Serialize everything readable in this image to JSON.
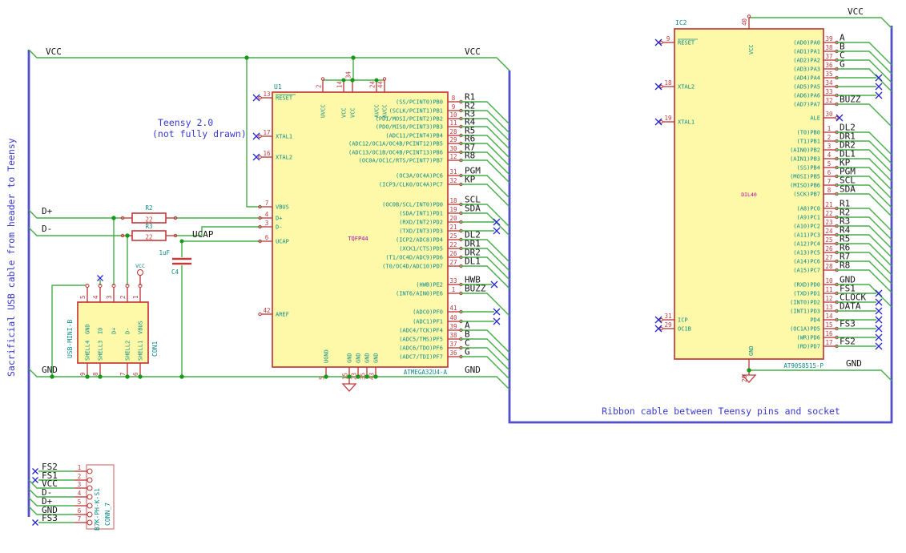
{
  "notes": {
    "left_cable": "Sacrificial USB cable from header to Teensy",
    "teensy_1": "Teensy 2.0",
    "teensy_2": "(not fully drawn)",
    "ribbon": "Ribbon cable between Teensy pins and socket"
  },
  "power": {
    "vcc": "VCC",
    "gnd": "GND"
  },
  "nets": {
    "dplus": "D+",
    "dminus": "D-",
    "ucap": "UCAP"
  },
  "u1": {
    "ref": "U1",
    "value": "ATMEGA32U4-A",
    "footprint": "TQFP44",
    "top_pins": [
      {
        "num": "2",
        "name": "UVCC"
      },
      {
        "num": "14",
        "name": "VCC"
      },
      {
        "num": "34",
        "name": "VCC"
      },
      {
        "num": "24",
        "name": "AVCC"
      },
      {
        "num": "44",
        "name": "AVCC"
      }
    ],
    "bottom_pins": [
      {
        "num": "5",
        "name": "UGND"
      },
      {
        "num": "15",
        "name": "GND"
      },
      {
        "num": "23",
        "name": "GND"
      },
      {
        "num": "35",
        "name": "GND"
      },
      {
        "num": "43",
        "name": "GND"
      }
    ],
    "left_pins": [
      {
        "num": "13",
        "name": "RESET"
      },
      {
        "num": "17",
        "name": "XTAL1"
      },
      {
        "num": "16",
        "name": "XTAL2"
      },
      {
        "num": "7",
        "name": "VBUS"
      },
      {
        "num": "4",
        "name": "D+"
      },
      {
        "num": "3",
        "name": "D-"
      },
      {
        "num": "6",
        "name": "UCAP"
      },
      {
        "num": "42",
        "name": "AREF"
      }
    ],
    "right_pins": [
      {
        "num": "8",
        "name": "(SS/PCINT0)PB0",
        "net": "R1"
      },
      {
        "num": "9",
        "name": "(SCLK/PCINT1)PB1",
        "net": "R2"
      },
      {
        "num": "10",
        "name": "(PDI/MOSI/PCINT2)PB2",
        "net": "R3"
      },
      {
        "num": "11",
        "name": "(PDO/MISO/PCINT3)PB3",
        "net": "R4"
      },
      {
        "num": "28",
        "name": "(ADC11/PCINT4)PB4",
        "net": "R5"
      },
      {
        "num": "29",
        "name": "(ADC12/OC1A/OC4B/PCINT12)PB5",
        "net": "R6"
      },
      {
        "num": "30",
        "name": "(ADC13/OC1B/OC4B/PCINT13)PB6",
        "net": "R7"
      },
      {
        "num": "12",
        "name": "(OC0A/OC1C/RTS/PCINT7)PB7",
        "net": "R8"
      },
      {
        "num": "31",
        "name": "(OC3A/OC4A)PC6",
        "net": "PGM"
      },
      {
        "num": "32",
        "name": "(ICP3/CLK0/OC4A)PC7",
        "net": "KP"
      },
      {
        "num": "18",
        "name": "(OC0B/SCL/INT0)PD0",
        "net": "SCL"
      },
      {
        "num": "19",
        "name": "(SDA/INT1)PD1",
        "net": "SDA"
      },
      {
        "num": "20",
        "name": "(RXD/INT2)PD2",
        "net": ""
      },
      {
        "num": "21",
        "name": "(TXD/INT3)PD3",
        "net": ""
      },
      {
        "num": "25",
        "name": "(ICP2/ADC8)PD4",
        "net": "DL2"
      },
      {
        "num": "22",
        "name": "(XCK1/CTS)PD5",
        "net": "DR1"
      },
      {
        "num": "26",
        "name": "(T1/OC4D/ADC9)PD6",
        "net": "DR2"
      },
      {
        "num": "27",
        "name": "(T0/OC4D/ADC10)PD7",
        "net": "DL1"
      },
      {
        "num": "33",
        "name": "(HWB)PE2",
        "net": "HWB"
      },
      {
        "num": "1",
        "name": "(INT6/AIN0)PE6",
        "net": "BUZZ"
      },
      {
        "num": "41",
        "name": "(ADC0)PF0",
        "net": ""
      },
      {
        "num": "40",
        "name": "(ADC1)PF1",
        "net": ""
      },
      {
        "num": "39",
        "name": "(ADC4/TCK)PF4",
        "net": "A"
      },
      {
        "num": "38",
        "name": "(ADC5/TMS)PF5",
        "net": "B"
      },
      {
        "num": "37",
        "name": "(ADC6/TDO)PF6",
        "net": "C"
      },
      {
        "num": "36",
        "name": "(ADC7/TDI)PF7",
        "net": "G"
      }
    ]
  },
  "r2c": {
    "ref": "R2",
    "value": "22"
  },
  "r3c": {
    "ref": "R3",
    "value": "22"
  },
  "c4": {
    "ref": "C4",
    "value": "1uF"
  },
  "con1": {
    "ref": "CON1",
    "value": "USB-MINI-B",
    "top_pins": [
      {
        "num": "5",
        "name": "GND"
      },
      {
        "num": "4",
        "name": "ID"
      },
      {
        "num": "3",
        "name": "D+"
      },
      {
        "num": "2",
        "name": "D-"
      },
      {
        "num": "1",
        "name": "VBUS"
      }
    ],
    "bottom_pins": [
      {
        "num": "9",
        "name": "SHELL4"
      },
      {
        "num": "8",
        "name": "SHELL3"
      },
      {
        "num": "7",
        "name": "SHELL2"
      },
      {
        "num": "6",
        "name": "SHELL1"
      }
    ]
  },
  "conn7": {
    "ref": "CONN_7",
    "value": "B7K-PH-K-S1",
    "pins": [
      {
        "num": "1",
        "net": "FS2"
      },
      {
        "num": "2",
        "net": "FS1"
      },
      {
        "num": "3",
        "net": "VCC"
      },
      {
        "num": "4",
        "net": "D-"
      },
      {
        "num": "5",
        "net": "D+"
      },
      {
        "num": "6",
        "net": "GND"
      },
      {
        "num": "7",
        "net": "FS3"
      }
    ]
  },
  "ic2": {
    "ref": "IC2",
    "value": "AT90S8515-P",
    "footprint": "DIL40",
    "top_pin": {
      "num": "40",
      "name": "VCC"
    },
    "bottom_pin": {
      "num": "20",
      "name": "GND"
    },
    "left_pins": [
      {
        "num": "9",
        "name": "RESET"
      },
      {
        "num": "18",
        "name": "XTAL2"
      },
      {
        "num": "19",
        "name": "XTAL1"
      },
      {
        "num": "31",
        "name": "ICP"
      },
      {
        "num": "29",
        "name": "OC1B"
      }
    ],
    "right_pins": [
      {
        "num": "39",
        "name": "(AD0)PA0",
        "net": "A"
      },
      {
        "num": "38",
        "name": "(AD1)PA1",
        "net": "B"
      },
      {
        "num": "37",
        "name": "(AD2)PA2",
        "net": "C"
      },
      {
        "num": "36",
        "name": "(AD3)PA3",
        "net": "G"
      },
      {
        "num": "35",
        "name": "(AD4)PA4",
        "net": ""
      },
      {
        "num": "34",
        "name": "(AD5)PA5",
        "net": ""
      },
      {
        "num": "33",
        "name": "(AD6)PA6",
        "net": ""
      },
      {
        "num": "32",
        "name": "(AD7)PA7",
        "net": "BUZZ"
      },
      {
        "num": "30",
        "name": "ALE",
        "net": ""
      },
      {
        "num": "1",
        "name": "(T0)PB0",
        "net": "DL2"
      },
      {
        "num": "2",
        "name": "(T1)PB1",
        "net": "DR1"
      },
      {
        "num": "3",
        "name": "(AIN0)PB2",
        "net": "DR2"
      },
      {
        "num": "4",
        "name": "(AIN1)PB3",
        "net": "DL1"
      },
      {
        "num": "5",
        "name": "(SS)PB4",
        "net": "KP"
      },
      {
        "num": "6",
        "name": "(MOSI)PB5",
        "net": "PGM"
      },
      {
        "num": "7",
        "name": "(MISO)PB6",
        "net": "SCL"
      },
      {
        "num": "8",
        "name": "(SCK)PB7",
        "net": "SDA"
      },
      {
        "num": "21",
        "name": "(A8)PC0",
        "net": "R1"
      },
      {
        "num": "22",
        "name": "(A9)PC1",
        "net": "R2"
      },
      {
        "num": "23",
        "name": "(A10)PC2",
        "net": "R3"
      },
      {
        "num": "24",
        "name": "(A11)PC3",
        "net": "R4"
      },
      {
        "num": "25",
        "name": "(A12)PC4",
        "net": "R5"
      },
      {
        "num": "26",
        "name": "(A13)PC5",
        "net": "R6"
      },
      {
        "num": "27",
        "name": "(A14)PC6",
        "net": "R7"
      },
      {
        "num": "28",
        "name": "(A15)PC7",
        "net": "R8"
      },
      {
        "num": "10",
        "name": "(RXD)PD0",
        "net": "GND"
      },
      {
        "num": "11",
        "name": "(TXD)PD1",
        "net": "FS1"
      },
      {
        "num": "12",
        "name": "(INT0)PD2",
        "net": "CLOCK"
      },
      {
        "num": "13",
        "name": "(INT1)PD3",
        "net": "DATA"
      },
      {
        "num": "14",
        "name": "PD4",
        "net": ""
      },
      {
        "num": "15",
        "name": "(OC1A)PD5",
        "net": "FS3"
      },
      {
        "num": "16",
        "name": "(WR)PD6",
        "net": ""
      },
      {
        "num": "17",
        "name": "(RD)PD7",
        "net": "FS2"
      }
    ]
  }
}
